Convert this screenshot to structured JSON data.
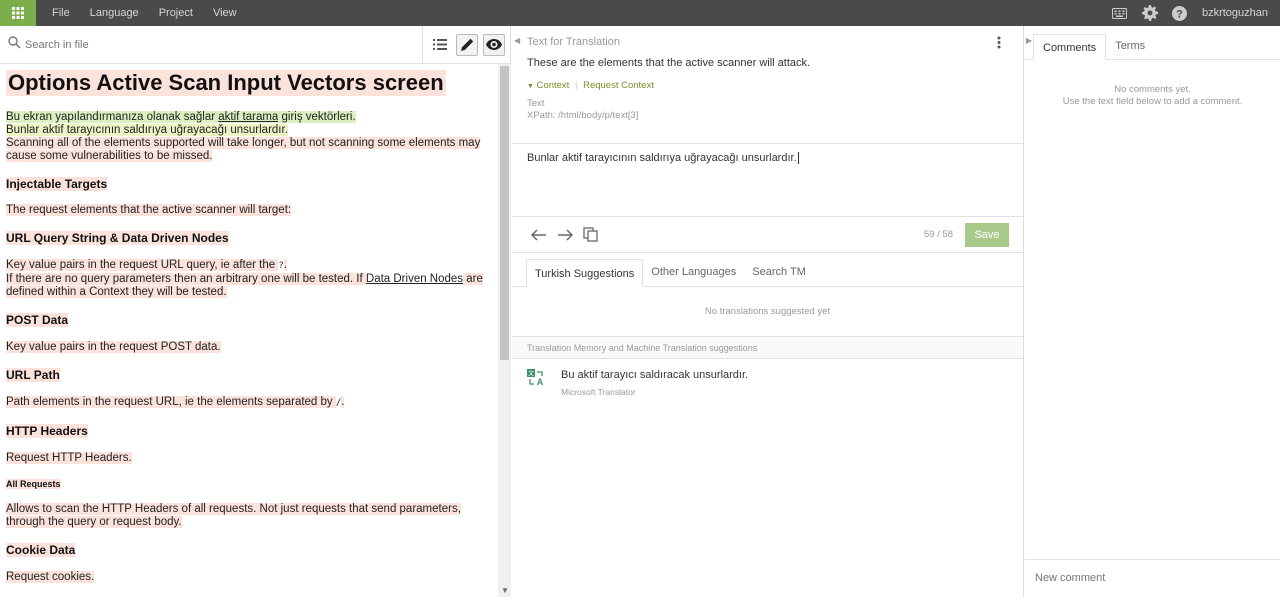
{
  "topbar": {
    "menu": [
      "File",
      "Language",
      "Project",
      "View"
    ],
    "username": "bzkrtoguzhan",
    "icons": [
      "apps-grid-icon",
      "keyboard-icon",
      "gear-icon",
      "help-icon"
    ]
  },
  "left": {
    "search_placeholder": "Search in file",
    "doc": {
      "title": "Options Active Scan Input Vectors screen",
      "intro_a": "Bu ekran yapılandırmanıza olanak sağlar ",
      "intro_link": "aktif tarama",
      "intro_b": " giriş vektörleri.",
      "intro2": "Bunlar aktif tarayıcının saldırıya uğrayacağı unsurlardır.",
      "intro3": "Scanning all of the elements supported will take longer, but not scanning some elements may cause some vulnerabilities to be missed.",
      "h_injectable": "Injectable Targets",
      "p_injectable": "The request elements that the active scanner will target:",
      "h_url_query": "URL Query String & Data Driven Nodes",
      "p_url_query1": "Key value pairs in the request URL query, ie after the ",
      "p_url_query1_code": "?",
      "p_url_query1_end": ".",
      "p_url_query2a": "If there are no query parameters then an arbitrary one will be tested. If ",
      "p_url_query2_link": "Data Driven Nodes",
      "p_url_query2b": " are defined within a Context they will be tested.",
      "h_post": "POST Data",
      "p_post": "Key value pairs in the request POST data.",
      "h_url_path": "URL Path",
      "p_url_path": "Path elements in the request URL, ie the elements separated by ",
      "p_url_path_code": "/",
      "p_url_path_end": ".",
      "h_http": "HTTP Headers",
      "p_http": "Request HTTP Headers.",
      "h_all": "All Requests",
      "p_all": "Allows to scan the HTTP Headers of all requests. Not just requests that send parameters, through the query or request body.",
      "h_cookie": "Cookie Data",
      "p_cookie": "Request cookies."
    }
  },
  "middle": {
    "source_label": "Text for Translation",
    "source_text": "These are the elements that the active scanner will attack.",
    "context_toggle": "Context",
    "request_context": "Request Context",
    "meta_type": "Text",
    "meta_xpath": "XPath: /html/body/p/text[3]",
    "translation": "Bunlar aktif tarayıcının saldırıya uğrayacağı unsurlardır.",
    "counter": "59 / 58",
    "save_label": "Save",
    "tabs": [
      "Turkish Suggestions",
      "Other Languages",
      "Search TM"
    ],
    "no_suggestions": "No translations suggested yet",
    "tm_header": "Translation Memory and Machine Translation suggestions",
    "tm_text": "Bu aktif tarayıcı saldıracak unsurlardır.",
    "tm_source": "Microsoft Translator"
  },
  "right": {
    "tabs": [
      "Comments",
      "Terms"
    ],
    "no_comments_1": "No comments yet.",
    "no_comments_2": "Use the text field below to add a comment.",
    "new_comment_placeholder": "New comment"
  }
}
